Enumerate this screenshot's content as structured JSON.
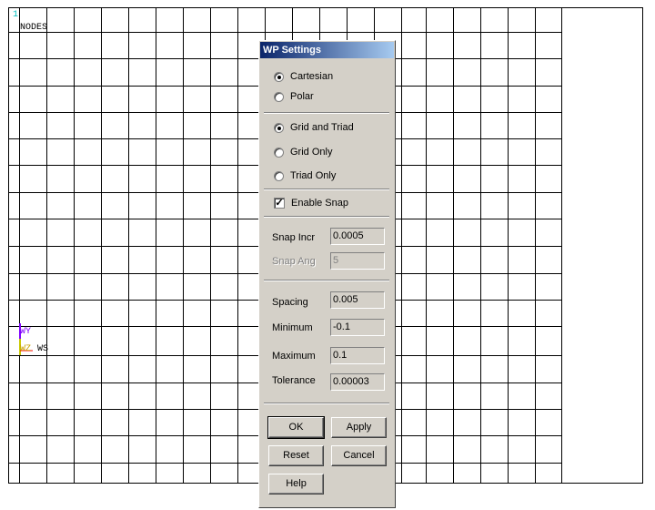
{
  "viewport": {
    "window_number": "1",
    "plot_title": "NODES",
    "triad": {
      "y_label": "WY",
      "z_label": "WZ",
      "ws_label": "WS"
    },
    "colors": {
      "grid": "#000000",
      "window_number": "#00c0c0",
      "y_axis": "#8000ff",
      "z_axis": "#c8c800",
      "triad_origin": "#ff0000"
    }
  },
  "dialog": {
    "title": "WP Settings",
    "coord_system": {
      "options": [
        "Cartesian",
        "Polar"
      ],
      "selected": "Cartesian"
    },
    "display": {
      "options": [
        "Grid and Triad",
        "Grid Only",
        "Triad Only"
      ],
      "selected": "Grid and Triad"
    },
    "enable_snap": {
      "label": "Enable Snap",
      "checked": true
    },
    "snap_incr": {
      "label": "Snap Incr",
      "value": "0.0005"
    },
    "snap_ang": {
      "label": "Snap Ang",
      "value": "5",
      "disabled": true
    },
    "spacing": {
      "label": "Spacing",
      "value": "0.005"
    },
    "minimum": {
      "label": "Minimum",
      "value": "-0.1"
    },
    "maximum": {
      "label": "Maximum",
      "value": "0.1"
    },
    "tolerance": {
      "label": "Tolerance",
      "value": "0.00003"
    },
    "buttons": {
      "ok": "OK",
      "apply": "Apply",
      "reset": "Reset",
      "cancel": "Cancel",
      "help": "Help"
    }
  }
}
